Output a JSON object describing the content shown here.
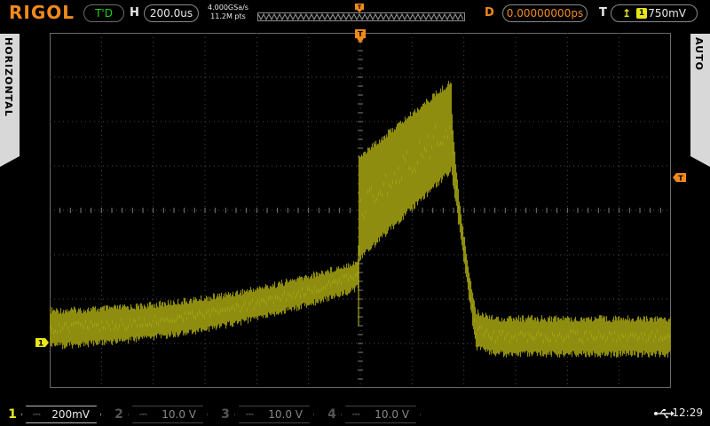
{
  "brand": "RIGOL",
  "status": "T'D",
  "horizontal": {
    "label": "H",
    "timebase": "200.0us",
    "sample_rate": "4.000GSa/s",
    "memory_depth": "11.2M pts"
  },
  "delay": {
    "label": "D",
    "value": "0.00000000ps"
  },
  "trigger": {
    "label": "T",
    "channel": "1",
    "level": "750mV",
    "slope_icon": "rising-edge-icon"
  },
  "side_tabs": {
    "left": "HORIZONTAL",
    "right": "AUTO"
  },
  "markers": {
    "trigger_top": "T",
    "channel_ground": "1",
    "trigger_level": "T"
  },
  "channels": [
    {
      "num": "1",
      "coupling": "⎓",
      "scale": "200mV",
      "active": true
    },
    {
      "num": "2",
      "coupling": "⎓",
      "scale": "10.0 V",
      "active": false
    },
    {
      "num": "3",
      "coupling": "⎓",
      "scale": "10.0 V",
      "active": false
    },
    {
      "num": "4",
      "coupling": "⎓",
      "scale": "10.0 V",
      "active": false
    }
  ],
  "clock": "12:29",
  "colors": {
    "trace": "#8f8d0f",
    "trace_bright": "#c9c61a",
    "accent_orange": "#f08a1c",
    "status_green": "#19d419",
    "grid": "#4a4a4a"
  }
}
